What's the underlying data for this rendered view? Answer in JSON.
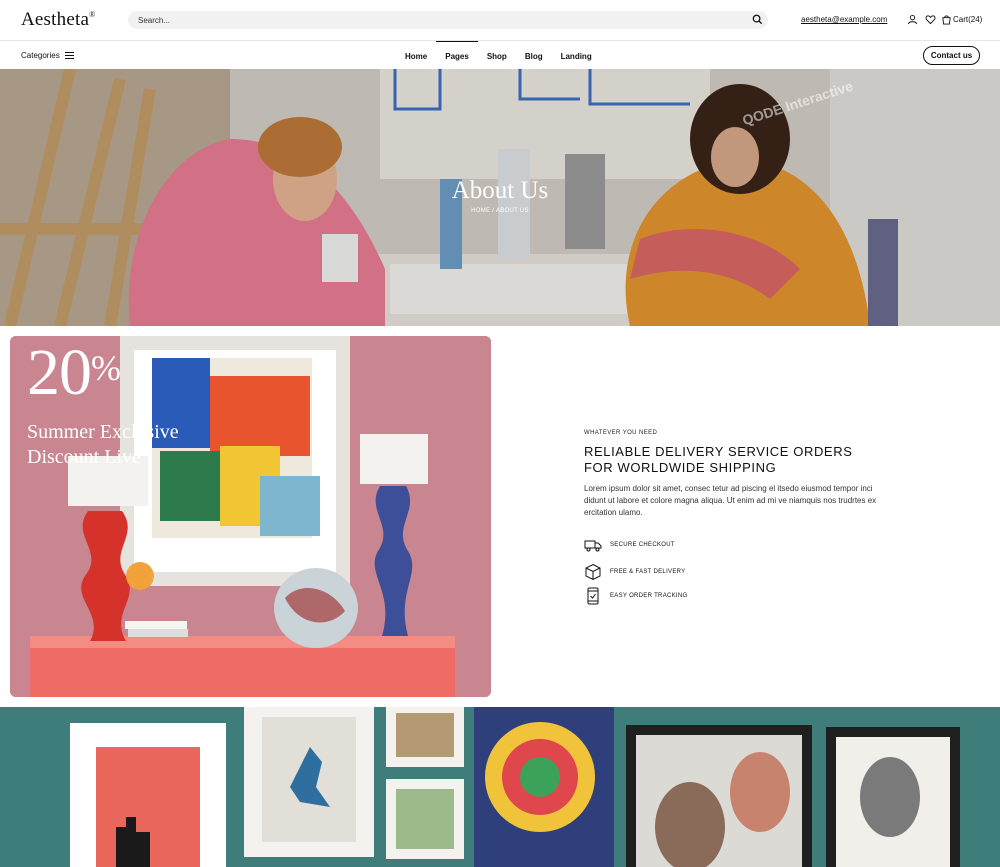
{
  "header": {
    "logo": "Aestheta",
    "logo_mark": "®",
    "search_placeholder": "Search...",
    "email": "aestheta@example.com",
    "cart_label": "Cart(24)"
  },
  "navbar": {
    "categories_label": "Categories",
    "items": [
      {
        "label": "Home"
      },
      {
        "label": "Pages"
      },
      {
        "label": "Shop"
      },
      {
        "label": "Blog"
      },
      {
        "label": "Landing"
      }
    ],
    "active_index": 1,
    "contact_label": "Contact us"
  },
  "hero": {
    "title": "About Us",
    "breadcrumb": "HOME / ABOUT US"
  },
  "promo": {
    "percent_value": "20",
    "percent_symbol": "%",
    "line1": "Summer Exclusive",
    "line2": "Discount Live"
  },
  "info": {
    "eyebrow": "WHATEVER YOU NEED",
    "title_line1": "RELIABLE DELIVERY SERVICE ORDERS",
    "title_line2": "FOR WORLDWIDE SHIPPING",
    "body": "Lorem ipsum dolor sit amet, consec tetur ad piscing el itsedo eiusmod tempor inci didunt ut labore et colore magna aliqua. Ut enim ad mi ve niamquis nos trudrtes ex ercitation ulamo.",
    "features": [
      {
        "label": "SECURE CHECKOUT",
        "icon": "truck-icon"
      },
      {
        "label": "FREE & FAST DELIVERY",
        "icon": "box-icon"
      },
      {
        "label": "EASY ORDER TRACKING",
        "icon": "phone-icon"
      }
    ]
  },
  "watermark": {
    "line1": "QODE",
    "line2": "Interactive"
  },
  "colors": {
    "accent": "#111111",
    "search_bg": "#f1f1f1",
    "promo_bg": "#c9848d",
    "gallery_bg": "#3f7f7c"
  }
}
